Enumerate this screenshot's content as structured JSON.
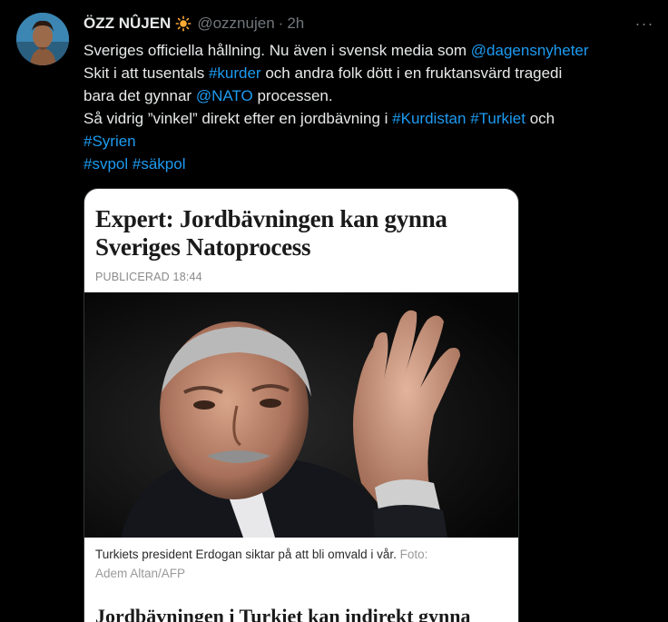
{
  "tweet": {
    "display_name": "ÖZZ NÛJEN",
    "handle": "@ozznujen",
    "separator": "·",
    "time": "2h",
    "more_label": "···",
    "icons": {
      "sun": "sun-icon",
      "more": "more-horizontal-icon"
    },
    "lines": [
      {
        "t1": "Sveriges officiella hållning. Nu även i svensk media som ",
        "link": "@dagensnyheter"
      },
      {
        "t1": "Skit i att tusentals ",
        "link": "#kurder",
        "t2": " och andra folk dött i en fruktansvärd tragedi"
      },
      {
        "t1": "bara det gynnar ",
        "link": "@NATO",
        "t2": " processen."
      },
      {
        "t1": "Så vidrig ”vinkel” direkt efter en jordbävning i ",
        "link1": "#Kurdistan",
        "sp": " ",
        "link2": "#Turkiet",
        "t2": " och"
      },
      {
        "link": "#Syrien"
      },
      {
        "link1": "#svpol",
        "sp": " ",
        "link2": "#säkpol"
      }
    ]
  },
  "card": {
    "title": "Expert: Jordbävningen kan gynna Sveriges Natoprocess",
    "published": "PUBLICERAD 18:44",
    "caption": "Turkiets president Erdogan siktar på att bli omvald i vår.",
    "credit_label": "Foto:",
    "credit_name": "Adem Altan/AFP",
    "subhead": "Jordbävningen i Turkiet kan indirekt gynna"
  },
  "colors": {
    "background": "#000000",
    "text": "#e7e9ea",
    "muted": "#71767b",
    "link": "#1d9bf0",
    "card_bg": "#ffffff"
  }
}
